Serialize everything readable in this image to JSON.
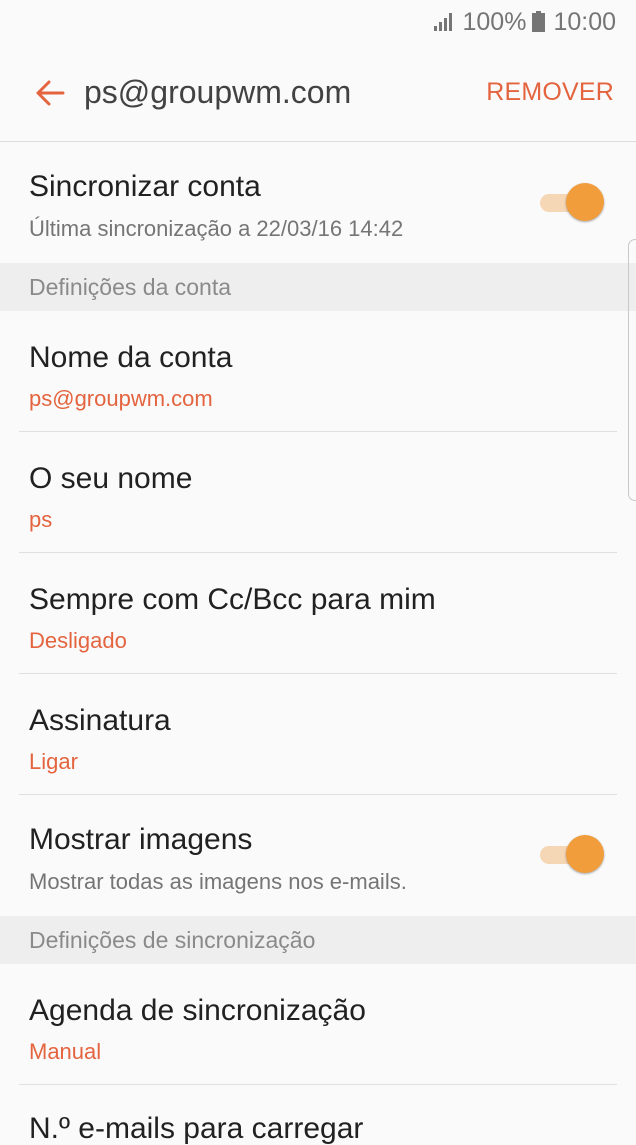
{
  "status_bar": {
    "battery_percent": "100%",
    "time": "10:00"
  },
  "app_bar": {
    "title": "ps@groupwm.com",
    "remove_label": "REMOVER"
  },
  "sync_account": {
    "title": "Sincronizar conta",
    "subtitle": "Última sincronização a 22/03/16 14:42",
    "enabled": true
  },
  "section_account": {
    "header": "Definições da conta"
  },
  "account_name": {
    "title": "Nome da conta",
    "value": "ps@groupwm.com"
  },
  "your_name": {
    "title": "O seu nome",
    "value": "ps"
  },
  "always_cc": {
    "title": "Sempre com Cc/Bcc para mim",
    "value": "Desligado"
  },
  "signature": {
    "title": "Assinatura",
    "value": "Ligar"
  },
  "show_images": {
    "title": "Mostrar imagens",
    "subtitle": "Mostrar todas as imagens nos e-mails.",
    "enabled": true
  },
  "section_sync": {
    "header": "Definições de sincronização"
  },
  "sync_schedule": {
    "title": "Agenda de sincronização",
    "value": "Manual"
  },
  "emails_to_load": {
    "title": "N.º e-mails para carregar"
  },
  "colors": {
    "accent": "#e3643f",
    "toggle_thumb": "#f19d3c",
    "toggle_track": "#f6d7b5"
  },
  "icons": {
    "back": "arrow-left",
    "signal": "cellular-signal",
    "battery": "battery-full"
  }
}
